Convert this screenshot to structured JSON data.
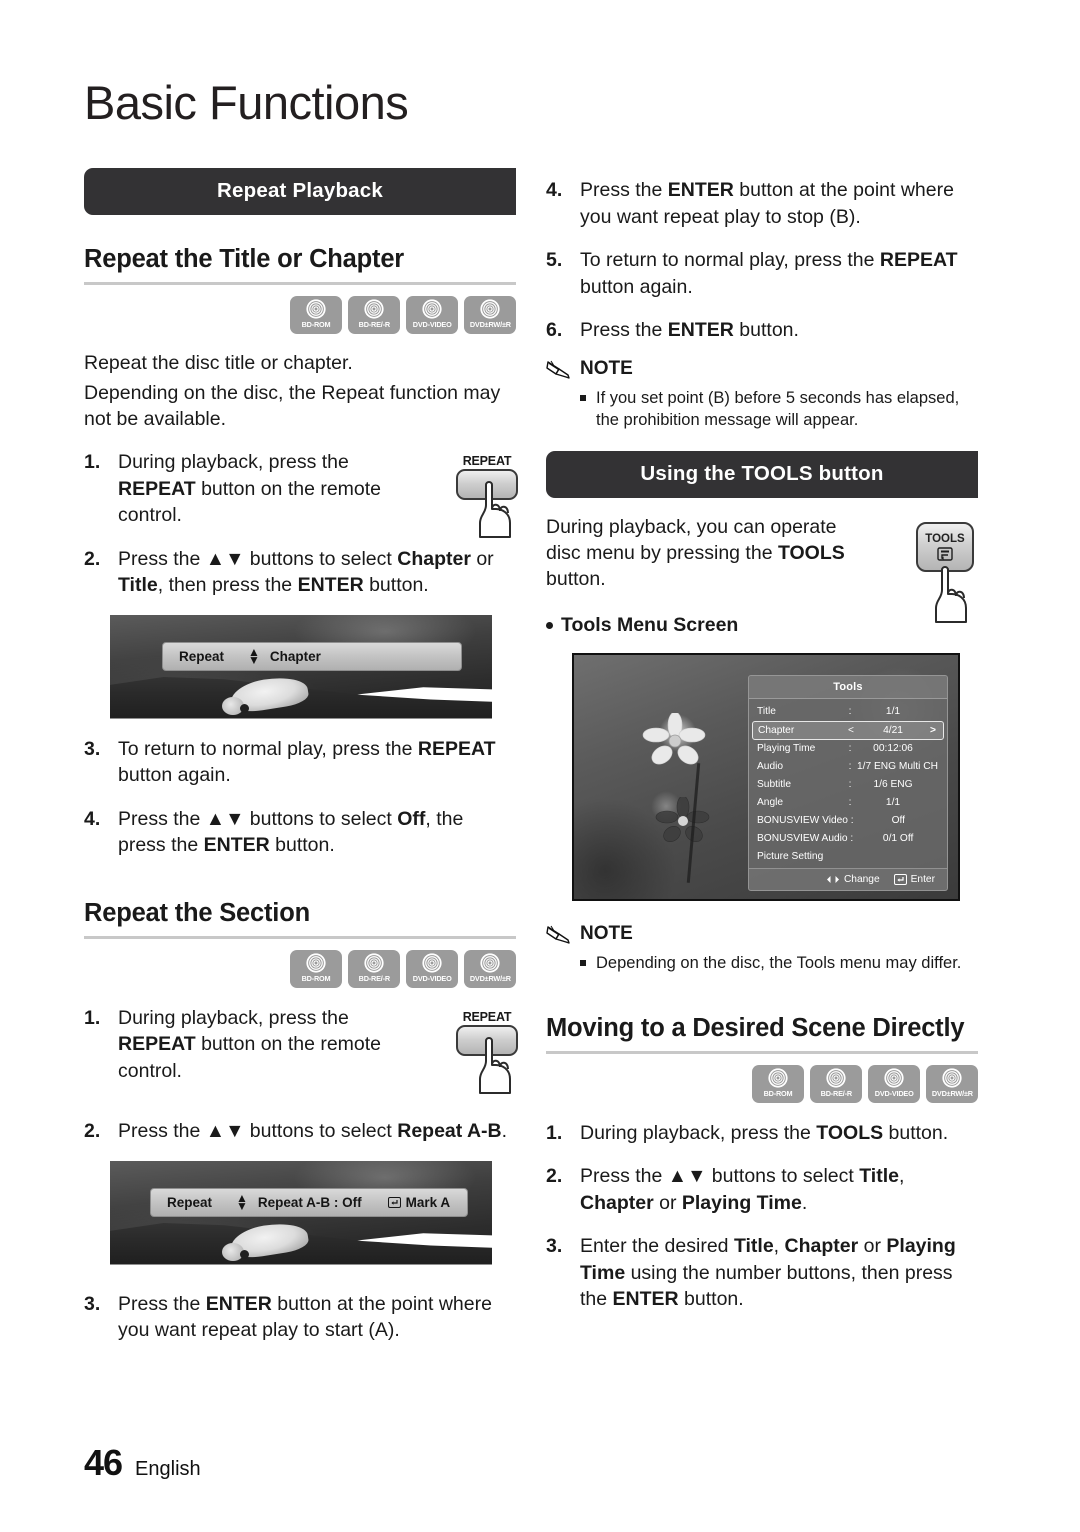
{
  "page": {
    "title": "Basic Functions",
    "number": "46",
    "language": "English"
  },
  "left_column": {
    "banner": "Repeat Playback",
    "section1": {
      "heading": "Repeat the Title or Chapter",
      "discs": [
        "BD-ROM",
        "BD-RE/-R",
        "DVD-VIDEO",
        "DVD±RW/±R"
      ],
      "intro1": "Repeat the disc title or chapter.",
      "intro2": "Depending on the disc, the Repeat function may not be available.",
      "steps": [
        {
          "num": "1.",
          "parts": [
            {
              "t": "During playback, press the ",
              "b": false
            },
            {
              "t": "REPEAT",
              "b": true
            },
            {
              "t": " button on the remote control.",
              "b": false
            }
          ]
        },
        {
          "num": "2.",
          "parts": [
            {
              "t": "Press the ▲▼ buttons to select ",
              "b": false
            },
            {
              "t": "Chapter",
              "b": true
            },
            {
              "t": " or ",
              "b": false
            },
            {
              "t": "Title",
              "b": true
            },
            {
              "t": ", then press the ",
              "b": false
            },
            {
              "t": "ENTER",
              "b": true
            },
            {
              "t": " button.",
              "b": false
            }
          ]
        },
        {
          "num": "3.",
          "parts": [
            {
              "t": "To return to normal play, press the ",
              "b": false
            },
            {
              "t": "REPEAT",
              "b": true
            },
            {
              "t": " button again.",
              "b": false
            }
          ]
        },
        {
          "num": "4.",
          "parts": [
            {
              "t": "Press the ▲▼ buttons to select ",
              "b": false
            },
            {
              "t": "Off",
              "b": true
            },
            {
              "t": ", the press the ",
              "b": false
            },
            {
              "t": "ENTER",
              "b": true
            },
            {
              "t": " button.",
              "b": false
            }
          ]
        }
      ],
      "remote_key": "REPEAT",
      "osd": {
        "label": "Repeat",
        "value": "Chapter"
      }
    },
    "section2": {
      "heading": "Repeat the Section",
      "discs": [
        "BD-ROM",
        "BD-RE/-R",
        "DVD-VIDEO",
        "DVD±RW/±R"
      ],
      "steps": [
        {
          "num": "1.",
          "parts": [
            {
              "t": "During playback, press the ",
              "b": false
            },
            {
              "t": "REPEAT",
              "b": true
            },
            {
              "t": " button on the remote control.",
              "b": false
            }
          ]
        },
        {
          "num": "2.",
          "parts": [
            {
              "t": "Press the ▲▼ buttons to select ",
              "b": false
            },
            {
              "t": "Repeat A-B",
              "b": true
            },
            {
              "t": ".",
              "b": false
            }
          ]
        },
        {
          "num": "3.",
          "parts": [
            {
              "t": "Press the ",
              "b": false
            },
            {
              "t": "ENTER",
              "b": true
            },
            {
              "t": " button at the point where you want repeat play to start (A).",
              "b": false
            }
          ]
        }
      ],
      "remote_key": "REPEAT",
      "osd": {
        "label": "Repeat",
        "value": "Repeat A-B : Off",
        "action": "Mark A"
      }
    }
  },
  "right_column": {
    "continued_steps": [
      {
        "num": "4.",
        "parts": [
          {
            "t": "Press the ",
            "b": false
          },
          {
            "t": "ENTER",
            "b": true
          },
          {
            "t": " button at the point where you want repeat play to stop (B).",
            "b": false
          }
        ]
      },
      {
        "num": "5.",
        "parts": [
          {
            "t": "To return to normal play, press the ",
            "b": false
          },
          {
            "t": "REPEAT",
            "b": true
          },
          {
            "t": " button again.",
            "b": false
          }
        ]
      },
      {
        "num": "6.",
        "parts": [
          {
            "t": "Press the ",
            "b": false
          },
          {
            "t": "ENTER",
            "b": true
          },
          {
            "t": " button.",
            "b": false
          }
        ]
      }
    ],
    "note1": {
      "title": "NOTE",
      "items": [
        "If you set point (B) before 5 seconds has elapsed, the prohibition message will appear."
      ]
    },
    "tools_section": {
      "banner": "Using the TOOLS button",
      "intro_parts": [
        {
          "t": "During playback, you can operate disc menu by pressing the ",
          "b": false
        },
        {
          "t": "TOOLS",
          "b": true
        },
        {
          "t": " button.",
          "b": false
        }
      ],
      "remote_key": "TOOLS",
      "subhead": "Tools Menu Screen",
      "menu": {
        "title": "Tools",
        "rows": [
          {
            "key": "Title",
            "sep": ":",
            "value": "1/1",
            "selected": false
          },
          {
            "key": "Chapter",
            "sep": "<",
            "value": "4/21",
            "right": ">",
            "selected": true
          },
          {
            "key": "Playing Time",
            "sep": ":",
            "value": "00:12:06",
            "selected": false
          },
          {
            "key": "Audio",
            "sep": ":",
            "value": "1/7 ENG Multi CH",
            "selected": false
          },
          {
            "key": "Subtitle",
            "sep": ":",
            "value": "1/6 ENG",
            "selected": false
          },
          {
            "key": "Angle",
            "sep": ":",
            "value": "1/1",
            "selected": false
          },
          {
            "key": "BONUSVIEW Video :",
            "sep": "",
            "value": "Off",
            "selected": false
          },
          {
            "key": "BONUSVIEW Audio :",
            "sep": "",
            "value": "0/1 Off",
            "selected": false
          },
          {
            "key": "Picture Setting",
            "sep": "",
            "value": "",
            "selected": false
          }
        ],
        "footer": {
          "change": "Change",
          "enter": "Enter"
        }
      }
    },
    "note2": {
      "title": "NOTE",
      "items": [
        "Depending on the disc, the Tools menu may differ."
      ]
    },
    "scene_section": {
      "heading": "Moving to a Desired Scene Directly",
      "discs": [
        "BD-ROM",
        "BD-RE/-R",
        "DVD-VIDEO",
        "DVD±RW/±R"
      ],
      "steps": [
        {
          "num": "1.",
          "parts": [
            {
              "t": "During playback, press the ",
              "b": false
            },
            {
              "t": "TOOLS",
              "b": true
            },
            {
              "t": " button.",
              "b": false
            }
          ]
        },
        {
          "num": "2.",
          "parts": [
            {
              "t": "Press the ▲▼ buttons to select ",
              "b": false
            },
            {
              "t": "Title",
              "b": true
            },
            {
              "t": ", ",
              "b": false
            },
            {
              "t": "Chapter",
              "b": true
            },
            {
              "t": " or ",
              "b": false
            },
            {
              "t": "Playing Time",
              "b": true
            },
            {
              "t": ".",
              "b": false
            }
          ]
        },
        {
          "num": "3.",
          "parts": [
            {
              "t": "Enter the desired ",
              "b": false
            },
            {
              "t": "Title",
              "b": true
            },
            {
              "t": ", ",
              "b": false
            },
            {
              "t": "Chapter",
              "b": true
            },
            {
              "t": " or ",
              "b": false
            },
            {
              "t": "Playing Time",
              "b": true
            },
            {
              "t": " using the number buttons, then press the ",
              "b": false
            },
            {
              "t": "ENTER",
              "b": true
            },
            {
              "t": " button.",
              "b": false
            }
          ]
        }
      ]
    }
  },
  "colors": {
    "banner_bg": "#333234",
    "rule": "#c8c8c8",
    "disc_bg": "#9b9b9b",
    "text": "#1a1a1a"
  }
}
